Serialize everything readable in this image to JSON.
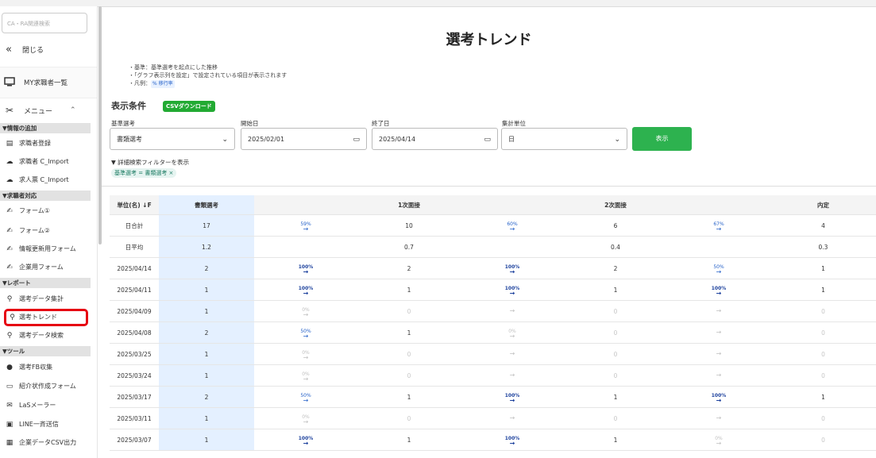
{
  "sidebar": {
    "search_placeholder": "CA・RA関連検索",
    "close_label": "閉じる",
    "my_jobseekers_label": "MY求職者一覧",
    "menu_label": "メニュー",
    "sections": [
      {
        "title": "▼情報の追加",
        "items": [
          {
            "label": "求職者登録",
            "icon": "id-card-icon"
          },
          {
            "label": "求職者 C_Import",
            "icon": "cloud-icon"
          },
          {
            "label": "求人票 C_Import",
            "icon": "cloud-icon"
          }
        ]
      },
      {
        "title": "▼求職者対応",
        "items": [
          {
            "label": "フォーム①",
            "icon": "form-icon"
          },
          {
            "label": "フォーム②",
            "icon": "form-icon"
          },
          {
            "label": "情報更新用フォーム",
            "icon": "form-icon"
          },
          {
            "label": "企業用フォーム",
            "icon": "form-icon"
          }
        ]
      },
      {
        "title": "▼レポート",
        "items": [
          {
            "label": "選考データ集計",
            "icon": "search-icon"
          },
          {
            "label": "選考トレンド",
            "icon": "search-icon"
          },
          {
            "label": "選考データ検索",
            "icon": "search-icon"
          }
        ]
      },
      {
        "title": "▼ツール",
        "items": [
          {
            "label": "選考FB収集",
            "icon": "chat-icon"
          },
          {
            "label": "紹介状作成フォーム",
            "icon": "document-icon"
          },
          {
            "label": "LaSメーラー",
            "icon": "mail-icon"
          },
          {
            "label": "LINE一斉送信",
            "icon": "line-icon"
          },
          {
            "label": "企業データCSV出力",
            "icon": "grid-icon"
          }
        ]
      }
    ]
  },
  "main": {
    "title": "選考トレンド",
    "notes": [
      "・基準：基準選考を起点にした推移",
      "・「グラフ表示列を設定」で設定されている項目が表示されます",
      "・凡例："
    ],
    "legend_badge": "% 移行率",
    "conditions_title": "表示条件",
    "csv_button": "CSVダウンロード",
    "fields": {
      "base_selection": {
        "label": "基準選考",
        "value": "書類選考"
      },
      "start_date": {
        "label": "開始日",
        "value": "2025/02/01"
      },
      "end_date": {
        "label": "終了日",
        "value": "2025/04/14"
      },
      "unit": {
        "label": "集計単位",
        "value": "日"
      }
    },
    "show_button": "表示",
    "filter_toggle": "▼ 詳細検索フィルターを表示",
    "filter_chip": "基準選考 = 書類選考 ×"
  },
  "table": {
    "headers": [
      "単位(名) ↓F",
      "書類選考",
      "",
      "1次面接",
      "",
      "2次面接",
      "",
      "内定"
    ],
    "rows": [
      [
        "日合計",
        "17",
        "59%",
        "10",
        "60%",
        "6",
        "67%",
        "4"
      ],
      [
        "日平均",
        "1.2",
        "",
        "0.7",
        "",
        "0.4",
        "",
        "0.3"
      ],
      [
        "2025/04/14",
        "2",
        "100%",
        "2",
        "100%",
        "2",
        "50%",
        "1"
      ],
      [
        "2025/04/11",
        "1",
        "100%",
        "1",
        "100%",
        "1",
        "100%",
        "1"
      ],
      [
        "2025/04/09",
        "1",
        "0%",
        "0",
        "",
        "0",
        "",
        "0"
      ],
      [
        "2025/04/08",
        "2",
        "50%",
        "1",
        "0%",
        "0",
        "",
        "0"
      ],
      [
        "2025/03/25",
        "1",
        "0%",
        "0",
        "",
        "0",
        "",
        "0"
      ],
      [
        "2025/03/24",
        "1",
        "0%",
        "0",
        "",
        "0",
        "",
        "0"
      ],
      [
        "2025/03/17",
        "2",
        "50%",
        "1",
        "100%",
        "1",
        "100%",
        "1"
      ],
      [
        "2025/03/11",
        "1",
        "0%",
        "0",
        "",
        "0",
        "",
        "0"
      ],
      [
        "2025/03/07",
        "1",
        "100%",
        "1",
        "100%",
        "1",
        "0%",
        "0"
      ]
    ]
  }
}
